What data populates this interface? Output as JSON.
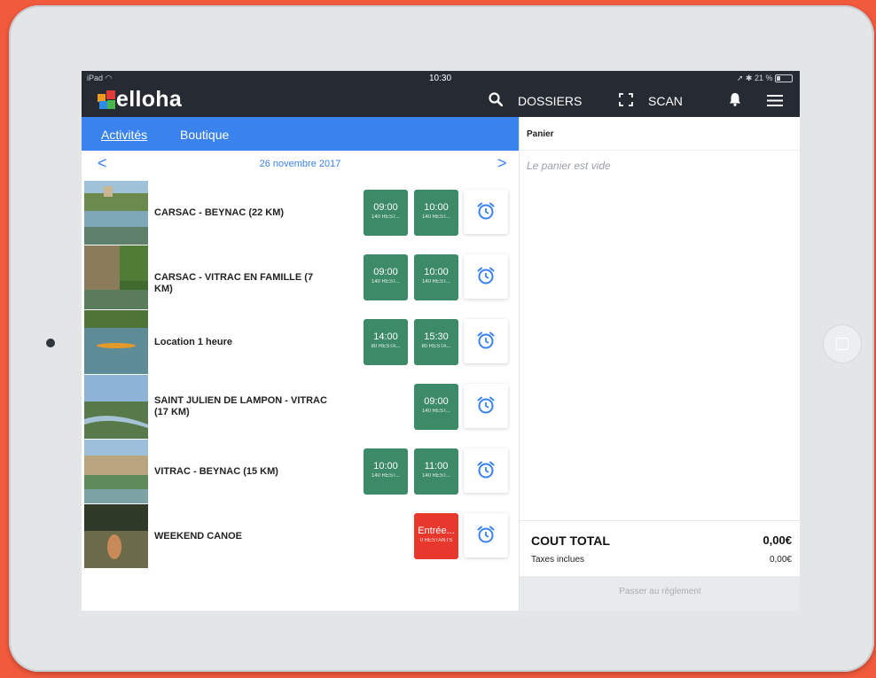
{
  "status": {
    "carrier": "iPad",
    "time": "10:30",
    "battery": "21 %"
  },
  "app": {
    "logo_text": "elloha"
  },
  "topnav": {
    "dossiers": "DOSSIERS",
    "scan": "SCAN"
  },
  "tabs": [
    {
      "label": "Activités",
      "active": true
    },
    {
      "label": "Boutique",
      "active": false
    }
  ],
  "date_nav": {
    "prev": "<",
    "date": "26 novembre 2017",
    "next": ">"
  },
  "activities": [
    {
      "title": "CARSAC - BEYNAC (22 KM)",
      "slots": [
        {
          "time": "09:00",
          "count": "140 REST..."
        },
        {
          "time": "10:00",
          "count": "140 REST..."
        }
      ]
    },
    {
      "title": "CARSAC - VITRAC EN FAMILLE (7 KM)",
      "slots": [
        {
          "time": "09:00",
          "count": "140 REST..."
        },
        {
          "time": "10:00",
          "count": "140 REST..."
        }
      ]
    },
    {
      "title": "Location 1 heure",
      "slots": [
        {
          "time": "14:00",
          "count": "80 RESTA..."
        },
        {
          "time": "15:30",
          "count": "80 RESTA..."
        }
      ]
    },
    {
      "title": "SAINT JULIEN DE LAMPON - VITRAC (17 KM)",
      "slots": [
        {
          "time": "09:00",
          "count": "140 REST..."
        }
      ]
    },
    {
      "title": "VITRAC - BEYNAC (15 KM)",
      "slots": [
        {
          "time": "10:00",
          "count": "140 REST..."
        },
        {
          "time": "11:00",
          "count": "140 REST..."
        }
      ]
    },
    {
      "title": "WEEKEND CANOE",
      "slots": [
        {
          "time": "Entrée...",
          "count": "0 RESTANTS"
        }
      ]
    }
  ],
  "cart": {
    "header": "Panier",
    "empty": "Le panier est vide",
    "total_label": "COUT TOTAL",
    "total_value": "0,00€",
    "tax_label": "Taxes inclues",
    "tax_value": "0,00€",
    "pay_button": "Passer au règlement"
  },
  "colors": {
    "accent": "#3a82ee",
    "slot": "#3c8a67",
    "slot_full": "#e8382d",
    "topbar": "#262b33",
    "background": "#f25a3d"
  }
}
